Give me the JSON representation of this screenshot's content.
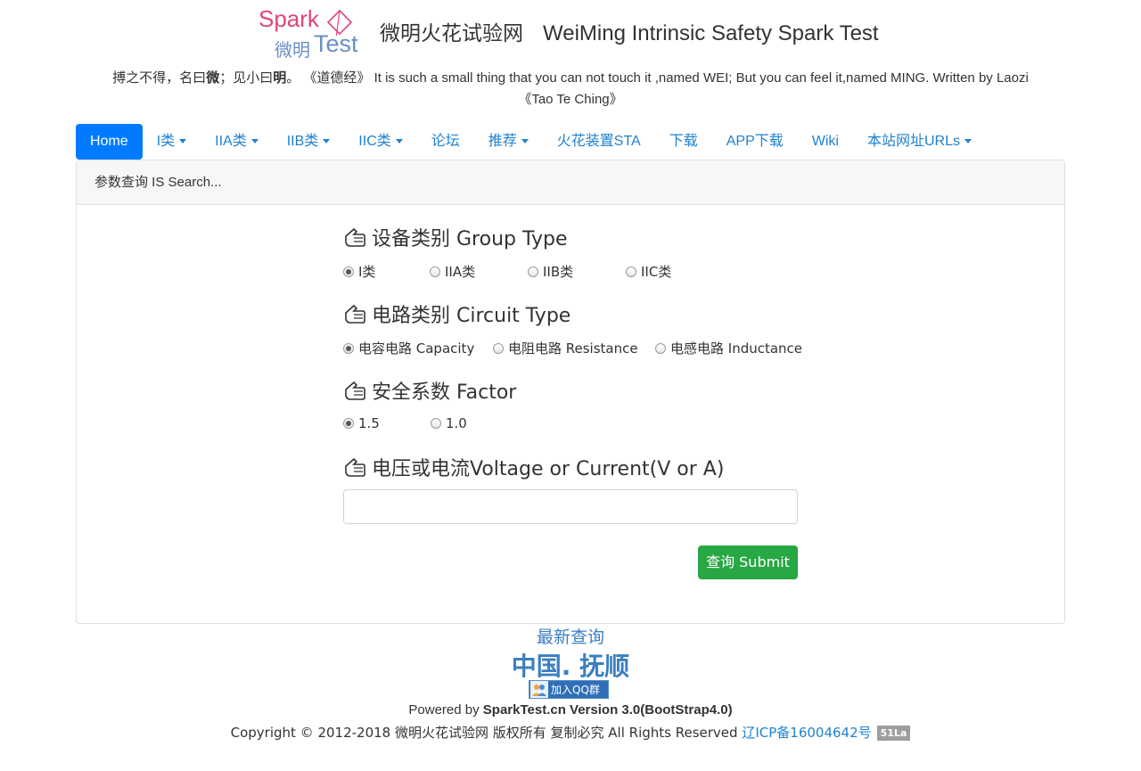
{
  "header": {
    "logo": {
      "spark": "Spark",
      "weiming": "微明",
      "test": "Test"
    },
    "title_cn": "微明火花试验网",
    "title_en": "WeiMing Intrinsic Safety Spark Test",
    "motto_part1": "搏之不得，名曰",
    "motto_wei": "微",
    "motto_part2": "；见小曰",
    "motto_ming": "明",
    "motto_part3": "。 《道德经》 It is such a small thing that you can not touch it ,named WEI; But you can feel it,named MING. Written by Laozi《Tao Te Ching》"
  },
  "nav": {
    "items": [
      {
        "label": "Home"
      },
      {
        "label": "I类"
      },
      {
        "label": "IIA类"
      },
      {
        "label": "IIB类"
      },
      {
        "label": "IIC类"
      },
      {
        "label": "论坛"
      },
      {
        "label": "推荐"
      },
      {
        "label": "火花装置STA"
      },
      {
        "label": "下载"
      },
      {
        "label": "APP下载"
      },
      {
        "label": "Wiki"
      },
      {
        "label": "本站网址URLs"
      }
    ]
  },
  "card": {
    "header": "参数查询 IS Search...",
    "group_title": "设备类别 Group Type",
    "group_options": [
      "I类",
      "IIA类",
      "IIB类",
      "IIC类"
    ],
    "group_selected": "I类",
    "circuit_title": "电路类别 Circuit Type",
    "circuit_options": [
      "电容电路 Capacity",
      "电阻电路 Resistance",
      "电感电路 Inductance"
    ],
    "circuit_selected": "电容电路 Capacity",
    "factor_title": "安全系数 Factor",
    "factor_options": [
      "1.5",
      "1.0"
    ],
    "factor_selected": "1.5",
    "input_title": "电压或电流Voltage or Current(V or A)",
    "input_value": "",
    "submit_label": "查询 Submit"
  },
  "footer": {
    "latest": "最新查询",
    "city": "中国. 抚顺",
    "qq_label": "加入QQ群",
    "powered_prefix": "Powered by ",
    "powered_bold": "SparkTest.cn Version 3.0(BootStrap4.0)",
    "copyright": "Copyright © 2012-2018 微明火花试验网 版权所有 复制必究 All Rights Reserved ",
    "icp": "辽ICP备16004642号",
    "la_badge": "51La"
  },
  "colors": {
    "accent": "#007bff",
    "link": "#1f82d1",
    "submit": "#28a745",
    "logo_pink": "#e0457b",
    "logo_blue": "#6a8fc7"
  }
}
